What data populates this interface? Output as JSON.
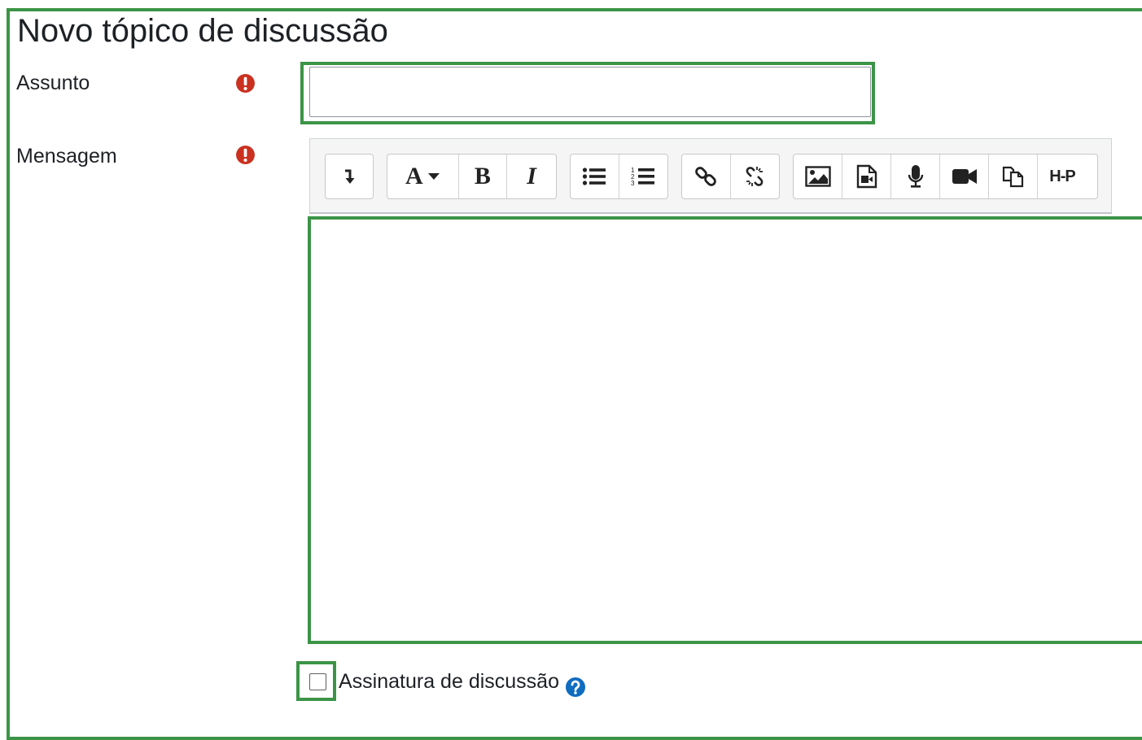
{
  "form": {
    "title": "Novo tópico de discussão",
    "subject": {
      "label": "Assunto",
      "value": "",
      "required": true
    },
    "message": {
      "label": "Mensagem",
      "required": true
    },
    "signature": {
      "label": "Assinatura de discussão",
      "checked": false
    }
  },
  "toolbar": {
    "font_letter": "A",
    "bold_letter": "B",
    "italic_letter": "I",
    "h5p_label": "H-P"
  },
  "colors": {
    "highlight": "#3c9447",
    "required": "#ca3120",
    "help": "#0f6cbf"
  },
  "icons": [
    "expand-toolbar-icon",
    "paragraph-styles-icon",
    "bold-icon",
    "italic-icon",
    "unordered-list-icon",
    "ordered-list-icon",
    "link-icon",
    "unlink-icon",
    "image-icon",
    "media-icon",
    "record-audio-icon",
    "record-video-icon",
    "manage-files-icon",
    "h5p-icon",
    "required-icon",
    "help-icon"
  ]
}
